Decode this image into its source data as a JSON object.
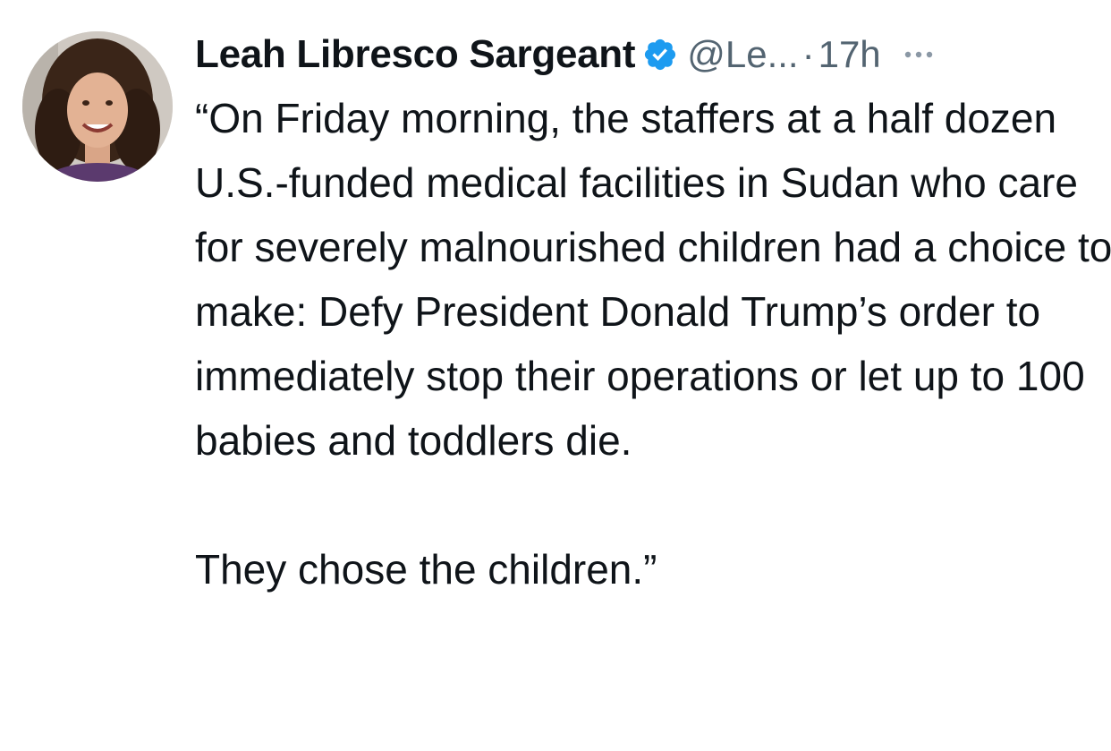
{
  "tweet": {
    "author": {
      "display_name": "Leah Libresco Sargeant",
      "handle": "@Le...",
      "verified": true
    },
    "separator": "·",
    "timestamp": "17h",
    "more_label": "···",
    "text": "“On Friday morning, the staffers at a half dozen U.S.-funded medical facilities in Sudan who care for severely malnourished children had a choice to make: Defy President Donald Trump’s order to immediately stop their operations or let up to 100 babies and toddlers die.\n\nThey chose the children.”"
  },
  "colors": {
    "verified_badge": "#1d9bf0",
    "secondary_text": "#536471",
    "primary_text": "#0f1419"
  },
  "icons": {
    "verified": "verified-badge-icon",
    "more": "more-horizontal-icon",
    "avatar": "user-avatar-photo"
  }
}
